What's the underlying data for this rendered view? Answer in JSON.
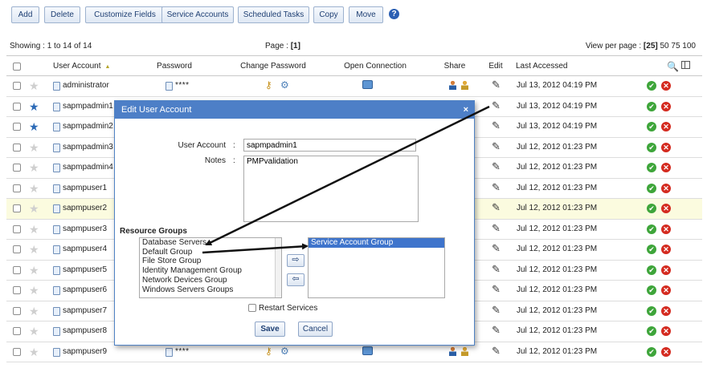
{
  "toolbar": {
    "add": "Add",
    "delete": "Delete",
    "customize_fields": "Customize Fields",
    "service_accounts": "Service Accounts",
    "scheduled_tasks": "Scheduled Tasks",
    "copy": "Copy",
    "move": "Move",
    "help": "?"
  },
  "pagination": {
    "showing": "Showing : 1 to 14 of 14",
    "page_label": "Page :",
    "page_current": "[1]",
    "view_label": "View per page :",
    "view_current": "[25]",
    "view_options": "50 75 100"
  },
  "columns": {
    "user_account": "User Account",
    "password": "Password",
    "change_password": "Change Password",
    "open_connection": "Open Connection",
    "share": "Share",
    "edit": "Edit",
    "last_accessed": "Last Accessed"
  },
  "icons": {
    "sort": "sort-ascending-icon",
    "favorite": "star-icon",
    "account": "document-icon",
    "change_password": "key-icon",
    "open_connection": "monitor-icon",
    "share": "users-icon",
    "edit": "pencil-icon",
    "ok": "check-icon",
    "delete": "delete-icon",
    "search": "search-icon",
    "columns": "columns-icon"
  },
  "rows": [
    {
      "account": "administrator",
      "password": "****",
      "accessed": "Jul 13, 2012 04:19 PM",
      "favorite": false
    },
    {
      "account": "sapmpadmin1",
      "password": "",
      "accessed": "Jul 13, 2012 04:19 PM",
      "favorite": true
    },
    {
      "account": "sapmpadmin2",
      "password": "",
      "accessed": "Jul 13, 2012 04:19 PM",
      "favorite": true
    },
    {
      "account": "sapmpadmin3",
      "password": "",
      "accessed": "Jul 12, 2012 01:23 PM",
      "favorite": false
    },
    {
      "account": "sapmpadmin4",
      "password": "",
      "accessed": "Jul 12, 2012 01:23 PM",
      "favorite": false
    },
    {
      "account": "sapmpuser1",
      "password": "",
      "accessed": "Jul 12, 2012 01:23 PM",
      "favorite": false
    },
    {
      "account": "sapmpuser2",
      "password": "",
      "accessed": "Jul 12, 2012 01:23 PM",
      "favorite": false
    },
    {
      "account": "sapmpuser3",
      "password": "",
      "accessed": "Jul 12, 2012 01:23 PM",
      "favorite": false
    },
    {
      "account": "sapmpuser4",
      "password": "",
      "accessed": "Jul 12, 2012 01:23 PM",
      "favorite": false
    },
    {
      "account": "sapmpuser5",
      "password": "",
      "accessed": "Jul 12, 2012 01:23 PM",
      "favorite": false
    },
    {
      "account": "sapmpuser6",
      "password": "",
      "accessed": "Jul 12, 2012 01:23 PM",
      "favorite": false
    },
    {
      "account": "sapmpuser7",
      "password": "",
      "accessed": "Jul 12, 2012 01:23 PM",
      "favorite": false
    },
    {
      "account": "sapmpuser8",
      "password": "",
      "accessed": "Jul 12, 2012 01:23 PM",
      "favorite": false
    },
    {
      "account": "sapmpuser9",
      "password": "****",
      "accessed": "Jul 12, 2012 01:23 PM",
      "favorite": false
    }
  ],
  "highlighted_row": "sapmpuser2",
  "dialog": {
    "title": "Edit User Account",
    "close": "×",
    "user_account_label": "User Account",
    "user_account_value": "sapmpadmin1",
    "notes_label": "Notes",
    "notes_value": "PMPvalidation",
    "resource_groups_label": "Resource Groups",
    "available_groups": [
      "Database Servers",
      "Default Group",
      "File Store Group",
      "Identity Management Group",
      "Network Devices Group",
      "Windows Servers Groups"
    ],
    "selected_groups": [
      "Service Account Group"
    ],
    "move_right": "⇨",
    "move_left": "⇦",
    "restart_services": "Restart Services",
    "save": "Save",
    "cancel": "Cancel"
  },
  "colors": {
    "dialog_title_bg": "#4d7fc7",
    "selected_option_bg": "#3e74cc",
    "favorite_star": "#2c6ab6",
    "highlight_row": "#fbfbdf"
  }
}
